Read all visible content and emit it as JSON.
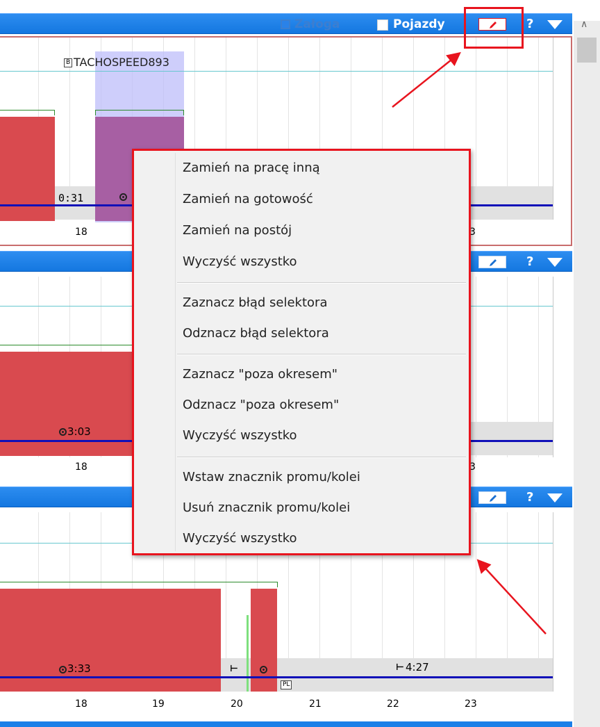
{
  "header1": {
    "crew_label": "Załoga",
    "vehicles_label": "Pojazdy",
    "help_label": "?"
  },
  "header2": {
    "help_label": "?"
  },
  "header3": {
    "help_label": "?"
  },
  "panel1": {
    "card_tag": "B",
    "card_label": "TACHOSPEED893",
    "time_label": "0:31",
    "axis": [
      "18",
      "3"
    ]
  },
  "panel2": {
    "time_label": "3:03",
    "axis": [
      "18",
      "3"
    ]
  },
  "panel3": {
    "time_label_1": "3:33",
    "time_label_2": "4:27",
    "country_tag": "PL",
    "axis": [
      "18",
      "19",
      "20",
      "21",
      "22",
      "23"
    ]
  },
  "context_menu": {
    "group1": [
      "Zamień na pracę inną",
      "Zamień na gotowość",
      "Zamień na postój",
      "Wyczyść wszystko"
    ],
    "group2": [
      "Zaznacz błąd selektora",
      "Odznacz błąd selektora"
    ],
    "group3": [
      "Zaznacz \"poza okresem\"",
      "Odznacz \"poza okresem\"",
      "Wyczyść wszystko"
    ],
    "group4": [
      "Wstaw znacznik promu/kolei",
      "Usuń znacznik promu/kolei",
      "Wyczyść wszystko"
    ]
  },
  "icons": {
    "edit": "pencil-icon",
    "menu": "triangle-down-icon",
    "scroll": "chevron-up-icon"
  },
  "colors": {
    "header_blue": "#1a7fe8",
    "activity_red": "#d94a4f",
    "selected_purple": "#a75fa3",
    "timeline_blue": "#1010b8",
    "annotation_red": "#e8141e"
  }
}
